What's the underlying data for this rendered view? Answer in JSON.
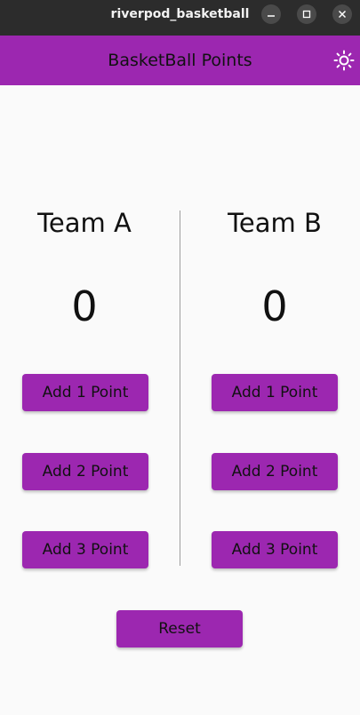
{
  "window": {
    "title": "riverpod_basketball"
  },
  "appbar": {
    "title": "BasketBall Points",
    "theme_toggle_icon": "sun-icon"
  },
  "team_a": {
    "name": "Team A",
    "score": "0",
    "buttons": [
      "Add 1 Point",
      "Add 2 Point",
      "Add 3 Point"
    ]
  },
  "team_b": {
    "name": "Team B",
    "score": "0",
    "buttons": [
      "Add 1 Point",
      "Add 2 Point",
      "Add 3 Point"
    ]
  },
  "reset": {
    "label": "Reset"
  },
  "colors": {
    "accent": "#9c27b0",
    "titlebar": "#2c2c2c",
    "background": "#fafafa"
  }
}
